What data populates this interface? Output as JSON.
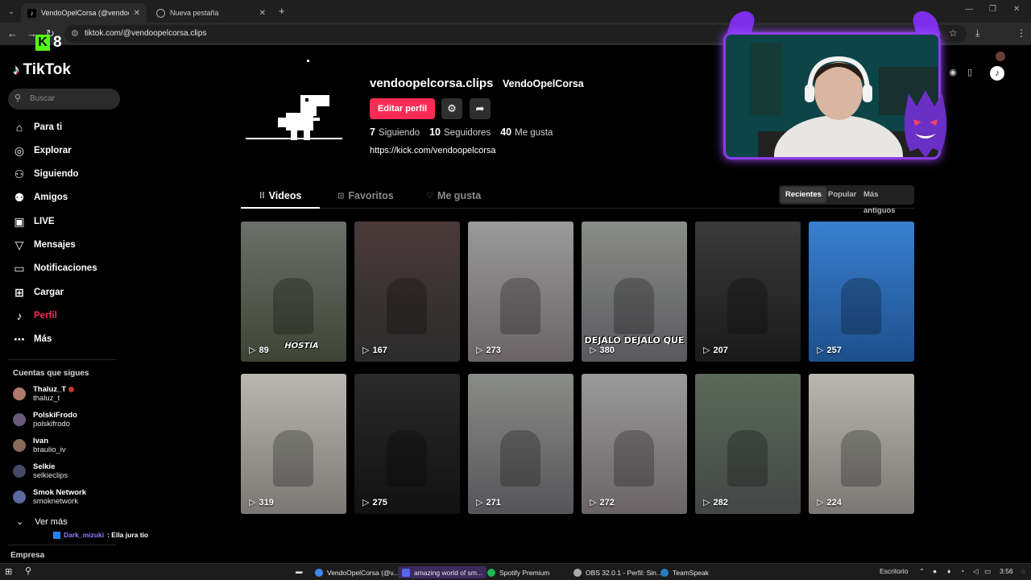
{
  "browser": {
    "tabs": [
      {
        "title": "VendoOpelCorsa (@vendoopel",
        "active": true
      },
      {
        "title": "Nueva pestaña",
        "active": false
      }
    ],
    "new_tab": "+",
    "url": "tiktok.com/@vendoopelcorsa.clips"
  },
  "kick": {
    "logo": "K",
    "count": "8"
  },
  "tiktok": {
    "brand": "TikTok",
    "search_placeholder": "Buscar",
    "nav": [
      {
        "label": "Para ti",
        "icon": "home-icon"
      },
      {
        "label": "Explorar",
        "icon": "compass-icon"
      },
      {
        "label": "Siguiendo",
        "icon": "following-icon"
      },
      {
        "label": "Amigos",
        "icon": "friends-icon"
      },
      {
        "label": "LIVE",
        "icon": "live-icon"
      },
      {
        "label": "Mensajes",
        "icon": "messages-icon"
      },
      {
        "label": "Notificaciones",
        "icon": "bell-icon"
      },
      {
        "label": "Cargar",
        "icon": "upload-icon"
      },
      {
        "label": "Perfil",
        "icon": "profile-icon"
      },
      {
        "label": "Más",
        "icon": "more-icon"
      }
    ],
    "following_title": "Cuentas que sigues",
    "accounts": [
      {
        "name": "Thaluz_T",
        "handle": "thaluz_t",
        "live": true,
        "color": "#b07a6a"
      },
      {
        "name": "PolskiFrodo",
        "handle": "polskifrodo",
        "live": false,
        "color": "#6a5a7a"
      },
      {
        "name": "Ivan",
        "handle": "braulio_iv",
        "live": false,
        "color": "#8a6a5a"
      },
      {
        "name": "Selkie",
        "handle": "selkieclips",
        "live": false,
        "color": "#444a66"
      },
      {
        "name": "Smok Network",
        "handle": "smoknetwork",
        "live": false,
        "color": "#5a6aa0"
      }
    ],
    "ver_mas": "Ver más",
    "chat_user": "Dark_mizuki",
    "chat_text": ": Ella jura tio",
    "empresa": "Empresa"
  },
  "profile": {
    "username": "vendoopelcorsa.clips",
    "nickname": "VendoOpelCorsa",
    "edit_button": "Editar perfil",
    "stats": [
      {
        "value": "7",
        "label": "Siguiendo"
      },
      {
        "value": "10",
        "label": "Seguidores"
      },
      {
        "value": "40",
        "label": "Me gusta"
      }
    ],
    "link": "https://kick.com/vendoopelcorsa",
    "tabs": [
      "Videos",
      "Favoritos",
      "Me gusta"
    ],
    "sort": [
      "Recientes",
      "Popular",
      "Más antiguos"
    ]
  },
  "videos": [
    {
      "views": "89",
      "caption": "HOSTIA",
      "bg": [
        "#6d6f6a",
        "#3e4436"
      ]
    },
    {
      "views": "167",
      "caption": "",
      "bg": [
        "#4a3a3a",
        "#2b2b2b"
      ]
    },
    {
      "views": "273",
      "caption": "",
      "bg": [
        "#9a9a9a",
        "#6a6466"
      ]
    },
    {
      "views": "380",
      "caption": "DEJALO DEJALO QUE",
      "bg": [
        "#8a8c88",
        "#5a5a5e"
      ]
    },
    {
      "views": "207",
      "caption": "",
      "bg": [
        "#3a3a3a",
        "#1a1a1a"
      ]
    },
    {
      "views": "257",
      "caption": "",
      "bg": [
        "#3a7fd0",
        "#1d4f8a"
      ]
    },
    {
      "views": "319",
      "caption": "",
      "bg": [
        "#b8b8b0",
        "#7a7874"
      ]
    },
    {
      "views": "275",
      "caption": "",
      "bg": [
        "#2a2a2a",
        "#111111"
      ]
    },
    {
      "views": "271",
      "caption": "",
      "bg": [
        "#8a8c88",
        "#555558"
      ]
    },
    {
      "views": "272",
      "caption": "",
      "bg": [
        "#9a9a9a",
        "#6a6466"
      ]
    },
    {
      "views": "282",
      "caption": "",
      "bg": [
        "#5a6a5a",
        "#444646"
      ]
    },
    {
      "views": "224",
      "caption": "",
      "bg": [
        "#b8b8b0",
        "#7a7874"
      ]
    }
  ],
  "taskbar": {
    "apps": [
      {
        "label": "VendoOpelCorsa (@v...",
        "color": "#4285f4"
      },
      {
        "label": "amazing world of sm...",
        "color": "#5865f2"
      },
      {
        "label": "Spotify Premium",
        "color": "#1db954"
      },
      {
        "label": "OBS 32.0.1 - Perfil: Sin...",
        "color": "#aaaaaa"
      },
      {
        "label": "TeamSpeak",
        "color": "#2580c3"
      }
    ],
    "desk": "Escritorio",
    "time": "3:56"
  },
  "colors": {
    "accent": "#fe2c55",
    "kick": "#53fc18",
    "overlay": "#8e3df0"
  }
}
